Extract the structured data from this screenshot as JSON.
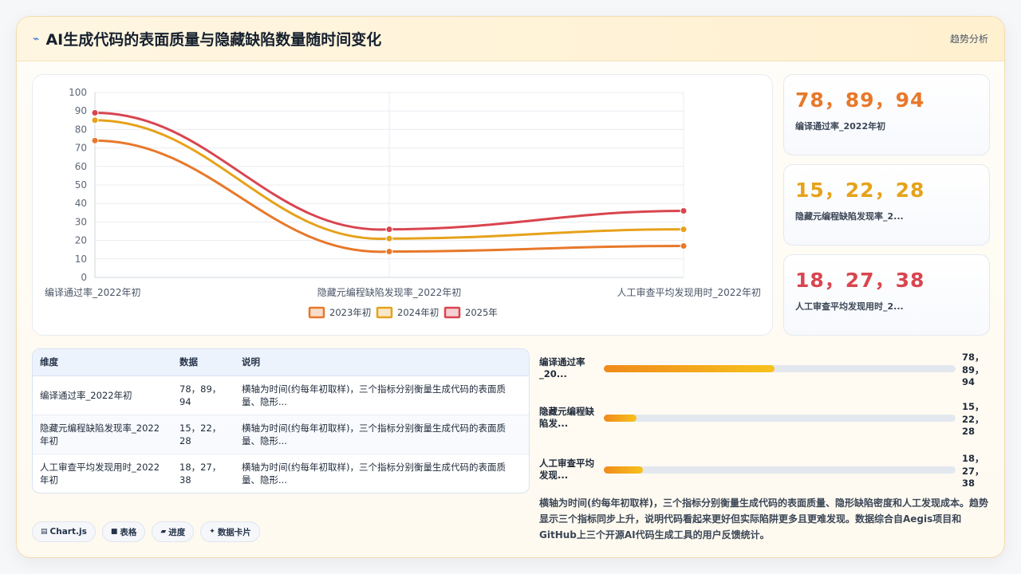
{
  "header": {
    "title": "AI生成代码的表面质量与隐藏缺陷数量随时间变化",
    "action": "趋势分析"
  },
  "chart_data": {
    "type": "line",
    "categories": [
      "编译通过率_2022年初",
      "隐藏元编程缺陷发现率_2022年初",
      "人工审查平均发现用时_2022年初"
    ],
    "series": [
      {
        "name": "2023年初",
        "values": [
          74,
          14,
          17
        ],
        "color": "#e8782a"
      },
      {
        "name": "2024年初",
        "values": [
          85,
          21,
          26
        ],
        "color": "#e6a21a"
      },
      {
        "name": "2025年",
        "values": [
          89,
          26,
          36
        ],
        "color": "#d9454f"
      }
    ],
    "ylim": [
      0,
      100
    ],
    "yticks": [
      0,
      10,
      20,
      30,
      40,
      50,
      60,
      70,
      80,
      90,
      100
    ],
    "grid": true,
    "legend": "bottom",
    "title": "",
    "xlabel": "",
    "ylabel": ""
  },
  "stats": [
    {
      "value": "78，89，94",
      "label": "编译通过率_2022年初",
      "color": "#e8782a"
    },
    {
      "value": "15，22，28",
      "label": "隐藏元编程缺陷发现率_2...",
      "color": "#e6a21a"
    },
    {
      "value": "18，27，38",
      "label": "人工审查平均发现用时_2...",
      "color": "#d9454f"
    }
  ],
  "table": {
    "headers": [
      "维度",
      "数据",
      "说明"
    ],
    "rows": [
      {
        "dim": "编译通过率_2022年初",
        "data": "78，89，94",
        "desc": "横轴为时间(约每年初取样)，三个指标分别衡量生成代码的表面质量、隐形..."
      },
      {
        "dim": "隐藏元编程缺陷发现率_2022年初",
        "data": "15，22，28",
        "desc": "横轴为时间(约每年初取样)，三个指标分别衡量生成代码的表面质量、隐形..."
      },
      {
        "dim": "人工审查平均发现用时_2022年初",
        "data": "18，27，38",
        "desc": "横轴为时间(约每年初取样)，三个指标分别衡量生成代码的表面质量、隐形..."
      }
    ]
  },
  "progress": [
    {
      "label": "编译通过率_20...",
      "value_text": "78，89，94",
      "fraction": 0.485
    },
    {
      "label": "隐藏元编程缺陷发...",
      "value_text": "15，22，28",
      "fraction": 0.093
    },
    {
      "label": "人工审查平均发现...",
      "value_text": "18，27，38",
      "fraction": 0.111
    }
  ],
  "description": "横轴为时间(约每年初取样)，三个指标分别衡量生成代码的表面质量、隐形缺陷密度和人工发现成本。趋势显示三个指标同步上升，说明代码看起来更好但实际陷阱更多且更难发现。数据综合自Aegis项目和GitHub上三个开源AI代码生成工具的用户反馈统计。",
  "chips": [
    {
      "icon": "chart-icon",
      "glyph": "▤",
      "label": "Chart.js"
    },
    {
      "icon": "table-icon",
      "glyph": "■",
      "label": "表格"
    },
    {
      "icon": "progress-icon",
      "glyph": "▰",
      "label": "进度"
    },
    {
      "icon": "card-icon",
      "glyph": "✦",
      "label": "数据卡片"
    }
  ]
}
